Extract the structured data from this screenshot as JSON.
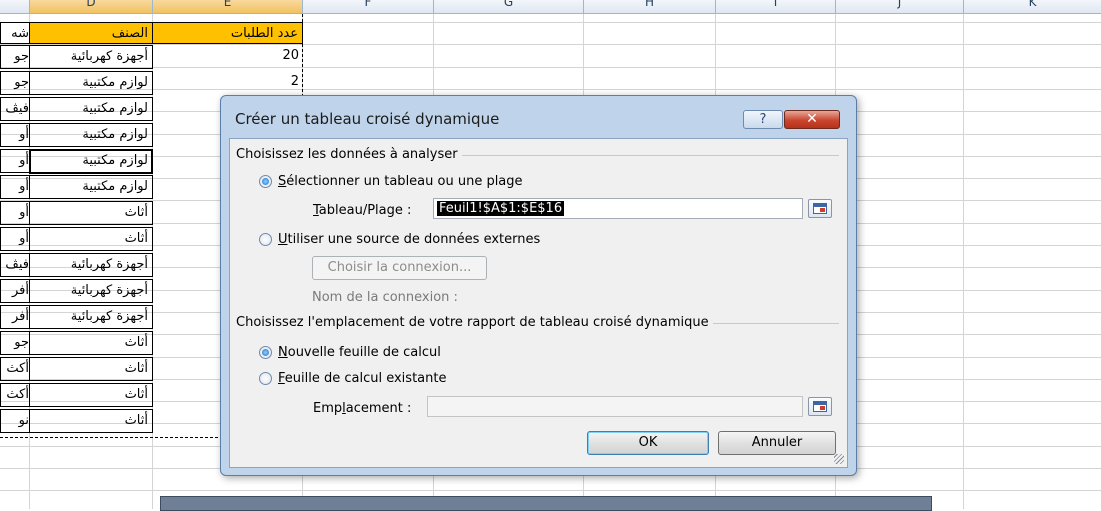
{
  "columns": [
    "D",
    "E",
    "F",
    "G",
    "H",
    "I",
    "J",
    "K"
  ],
  "sheet": {
    "col_c_header_partial": "شه",
    "col_d_header": "الصنف",
    "col_e_header": "عدد الطلبات",
    "col_c_values": [
      "جو",
      "جو",
      "فيڤ",
      "أو",
      "أو",
      "أو",
      "أو",
      "أو",
      "فيڤ",
      "أفر",
      "أفر",
      "جو",
      "أكث",
      "أكث",
      "نو"
    ],
    "col_d_values": [
      "أجهزة كهربائية",
      "لوازم مكتبية",
      "لوازم مكتبية",
      "لوازم مكتبية",
      "لوازم مكتبية",
      "لوازم مكتبية",
      "أثاث",
      "أثاث",
      "أجهزة كهربائية",
      "أجهزة كهربائية",
      "أجهزة كهربائية",
      "أثاث",
      "أثاث",
      "أثاث",
      "أثاث"
    ],
    "col_e_values": [
      "20",
      "2"
    ]
  },
  "dialog": {
    "title": "Créer un tableau croisé dynamique",
    "help_glyph": "?",
    "close_glyph": "✕",
    "section_data": "Choisissez les données à analyser",
    "opt_select_range_u": "S",
    "opt_select_range_rest": "électionner un tableau ou une plage",
    "range_label_u": "T",
    "range_label_rest": "ableau/Plage :",
    "range_value": "Feuil1!$A$1:$E$16",
    "opt_external_u": "U",
    "opt_external_rest": "tiliser une source de données externes",
    "choose_connection": "Choisir la connexion...",
    "connection_name_label": "Nom de la connexion :",
    "section_location": "Choisissez l'emplacement de votre rapport de tableau croisé dynamique",
    "opt_new_sheet_u": "N",
    "opt_new_sheet_rest": "ouvelle feuille de calcul",
    "opt_existing_sheet_u": "F",
    "opt_existing_sheet_rest": "euille de calcul existante",
    "location_label_pre": "Emp",
    "location_label_u": "l",
    "location_label_post": "acement :",
    "ok": "OK",
    "cancel": "Annuler",
    "selected_source": "range",
    "selected_location": "new-sheet"
  }
}
